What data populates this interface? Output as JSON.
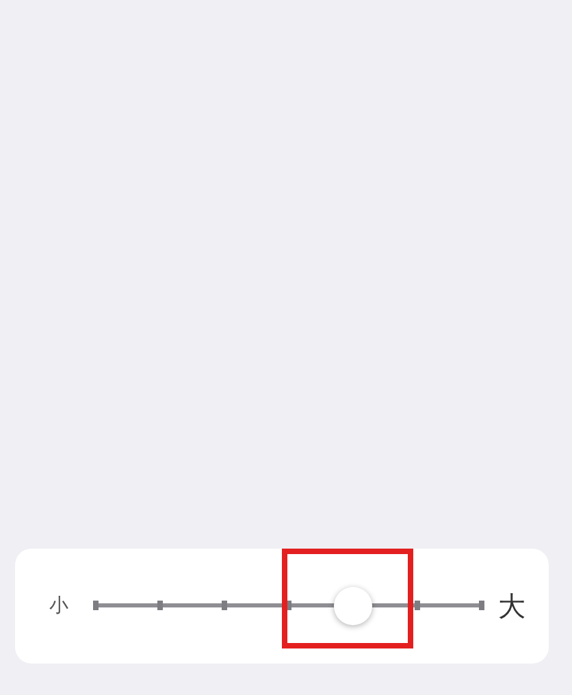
{
  "font_size_slider": {
    "min_label": "小",
    "max_label": "大",
    "level": 0.6667,
    "highlighted": true
  }
}
